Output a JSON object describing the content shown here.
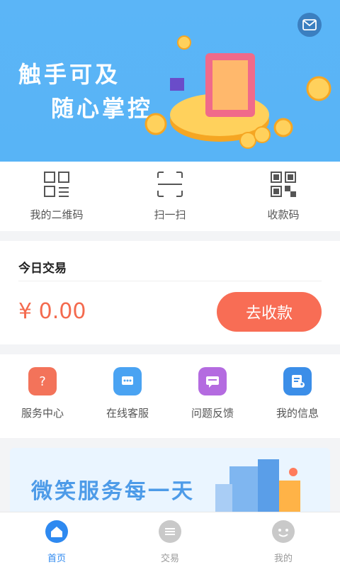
{
  "banner": {
    "line1": "触手可及",
    "line2": "随心掌控"
  },
  "quick_actions": [
    {
      "label": "我的二维码",
      "icon": "qrcode-outline-icon"
    },
    {
      "label": "扫一扫",
      "icon": "scan-icon"
    },
    {
      "label": "收款码",
      "icon": "qrcode-icon"
    }
  ],
  "today": {
    "title": "今日交易",
    "amount": "¥ 0.00",
    "collect_label": "去收款"
  },
  "services": [
    {
      "label": "服务中心",
      "icon": "service-center-icon",
      "color": "#f3735a"
    },
    {
      "label": "在线客服",
      "icon": "customer-service-icon",
      "color": "#4aa3f2"
    },
    {
      "label": "问题反馈",
      "icon": "feedback-icon",
      "color": "#b46be0"
    },
    {
      "label": "我的信息",
      "icon": "user-info-icon",
      "color": "#3b8ee8"
    }
  ],
  "promo": {
    "text": "微笑服务每一天"
  },
  "tabbar": [
    {
      "label": "首页",
      "icon": "home-icon",
      "active": true
    },
    {
      "label": "交易",
      "icon": "transaction-icon",
      "active": false
    },
    {
      "label": "我的",
      "icon": "profile-icon",
      "active": false
    }
  ],
  "colors": {
    "accent": "#2e89f0",
    "collect_button": "#f86d55",
    "amount": "#f46a4e",
    "banner": "#5bb5f7"
  }
}
